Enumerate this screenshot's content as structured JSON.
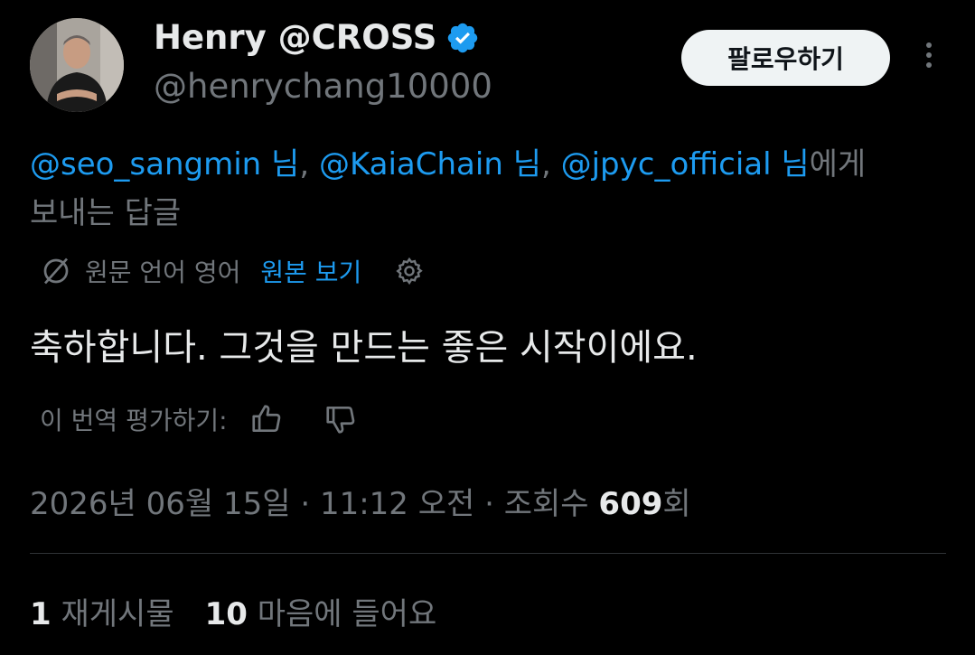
{
  "user": {
    "display_name": "Henry @CROSS",
    "handle": "@henrychang10000",
    "verified_icon": "verified-badge-icon",
    "verified_color": "#1d9bf0"
  },
  "actions": {
    "follow_label": "팔로우하기",
    "more_icon": "more-vertical-icon"
  },
  "reply_context": {
    "mentions": [
      "@seo_sangmin 님",
      "@KaiaChain 님",
      "@jpyc_official 님"
    ],
    "separator": ", ",
    "suffix_1": "에게",
    "suffix_2": "보내는 답글"
  },
  "translation": {
    "icon": "translate-globe-icon",
    "source_language": "원문 언어 영어",
    "view_original": "원본 보기",
    "settings_icon": "gear-icon"
  },
  "tweet": {
    "text": "축하합니다. 그것을 만드는 좋은 시작이에요."
  },
  "rating": {
    "label": "이 번역 평가하기:",
    "like_icon": "thumbs-up-icon",
    "dislike_icon": "thumbs-down-icon"
  },
  "meta": {
    "date": "2026년 06월 15일",
    "sep": " · ",
    "time": "11:12 오전",
    "views_label": "조회수 ",
    "views_count": "609",
    "views_suffix": "회"
  },
  "stats": {
    "reposts_count": "1",
    "reposts_label": " 재게시물",
    "likes_count": "10",
    "likes_label": " 마음에 들어요"
  },
  "colors": {
    "background": "#000000",
    "text_primary": "#e7e9ea",
    "text_secondary": "#71767b",
    "accent": "#1d9bf0"
  }
}
